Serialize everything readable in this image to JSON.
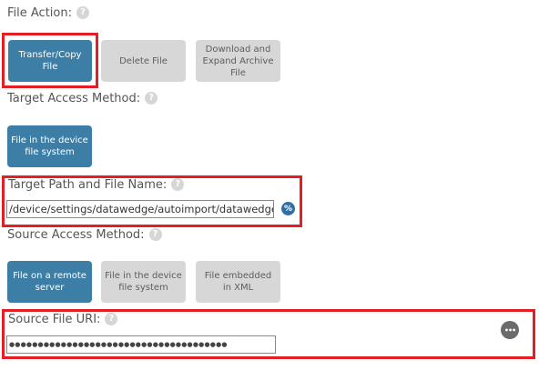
{
  "file_action": {
    "label": "File Action:",
    "help": "?",
    "options": [
      {
        "label": "Transfer/Copy File",
        "selected": true
      },
      {
        "label": "Delete File",
        "selected": false
      },
      {
        "label": "Download and Expand Archive File",
        "selected": false
      }
    ]
  },
  "target_access": {
    "label": "Target Access Method:",
    "help": "?",
    "options": [
      {
        "label": "File in the device file system",
        "selected": true
      }
    ]
  },
  "target_path": {
    "label": "Target Path and File Name:",
    "help": "?",
    "value": "/device/settings/datawedge/autoimport/datawedge.db",
    "variable_icon": "%"
  },
  "source_access": {
    "label": "Source Access Method:",
    "help": "?",
    "options": [
      {
        "label": "File on a remote server",
        "selected": true
      },
      {
        "label": "File in the device file system",
        "selected": false
      },
      {
        "label": "File embedded in XML",
        "selected": false
      }
    ]
  },
  "source_uri": {
    "label": "Source File URI:",
    "help": "?",
    "masked_value": "●●●●●●●●●●●●●●●●●●●●●●●●●●●●●●●●●●●●●●",
    "more_icon": "•••"
  },
  "colors": {
    "selected_button": "#3d7ea6",
    "unselected_button": "#d7d7d7",
    "highlight_border": "#e31e24",
    "variable_icon": "#2f6fa5",
    "more_icon": "#6b6b6b"
  }
}
